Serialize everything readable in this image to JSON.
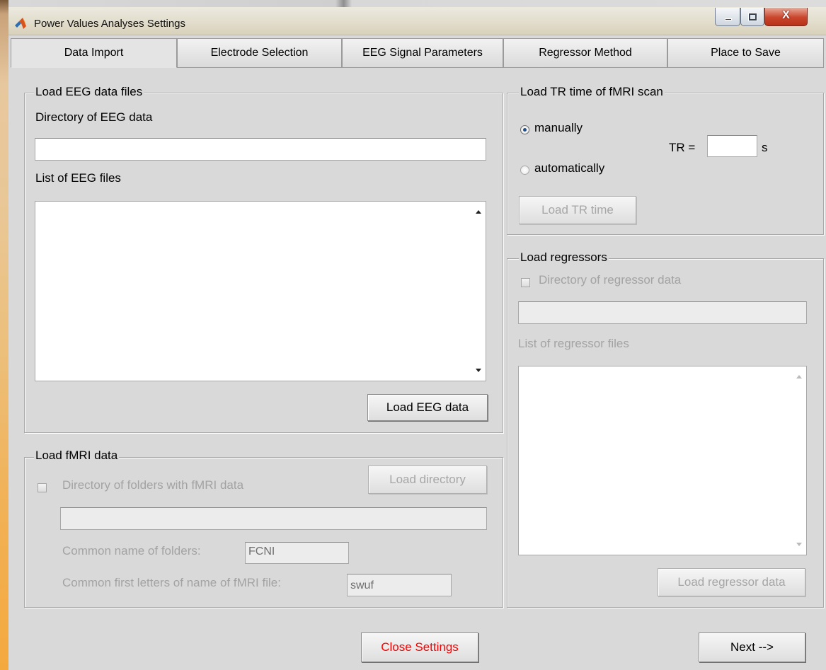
{
  "window": {
    "title": "Power Values Analyses Settings",
    "close_glyph": "X"
  },
  "tabs": [
    {
      "label": "Data Import",
      "active": true
    },
    {
      "label": "Electrode Selection"
    },
    {
      "label": "EEG Signal Parameters"
    },
    {
      "label": "Regressor Method"
    },
    {
      "label": "Place to Save"
    }
  ],
  "eeg": {
    "legend": "Load EEG data files",
    "directory_label": "Directory of EEG data",
    "directory_value": "",
    "list_label": "List of EEG files",
    "load_button": "Load EEG data"
  },
  "fmri": {
    "legend": "Load fMRI data",
    "directory_checkbox_label": "Directory of folders with fMRI data",
    "load_directory_button": "Load directory",
    "directory_value": "",
    "common_folders_label": "Common name of folders:",
    "common_folders_value": "FCNI",
    "common_letters_label": "Common first letters of name of fMRI file:",
    "common_letters_value": "swuf"
  },
  "tr": {
    "legend": "Load TR time of fMRI scan",
    "manual_label": "manually",
    "auto_label": "automatically",
    "tr_label": "TR =",
    "tr_value": "",
    "unit": "s",
    "load_button": "Load TR time",
    "selected": "manually"
  },
  "regressors": {
    "legend": "Load regressors",
    "directory_checkbox_label": "Directory of regressor data",
    "directory_value": "",
    "list_label": "List of regressor files",
    "load_button": "Load regressor data"
  },
  "footer": {
    "close_button": "Close Settings",
    "next_button": "Next -->"
  },
  "colors": {
    "close_text": "#ff0000",
    "panel_bg": "#d9d9d9",
    "disabled_text": "#a3a3a3"
  },
  "icons": {
    "app": "matlab-logo-icon",
    "minimize": "minimize-icon",
    "maximize": "maximize-icon",
    "close": "close-icon"
  }
}
